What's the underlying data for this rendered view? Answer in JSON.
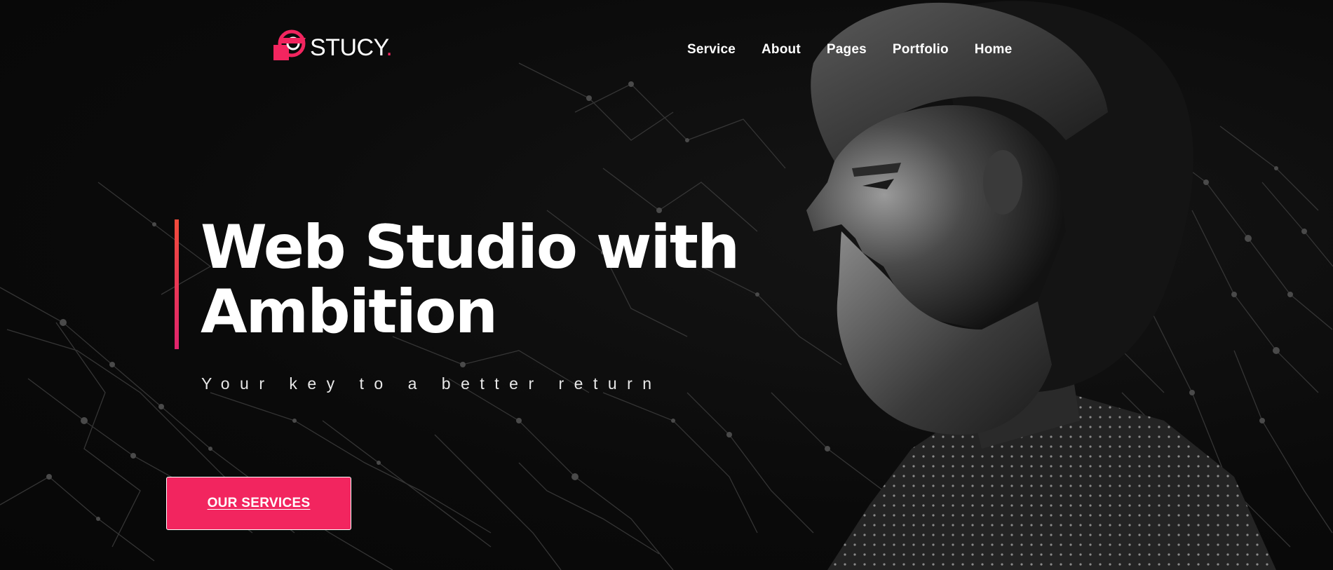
{
  "brand": {
    "name": "STUCY",
    "dot": ".",
    "accent_color": "#f2255f",
    "logo_icon": "stucy-logo-icon"
  },
  "nav": {
    "items": [
      {
        "label": "Service"
      },
      {
        "label": "About"
      },
      {
        "label": "Pages"
      },
      {
        "label": "Portfolio"
      },
      {
        "label": "Home"
      }
    ]
  },
  "hero": {
    "headline_line1": "Web Studio with",
    "headline_line2": "Ambition",
    "tagline": "Your key to a better return",
    "cta_label": "OUR SERVICES",
    "accent_gradient": [
      "#f24b3b",
      "#e0246d"
    ],
    "background_color": "#0b0b0b"
  }
}
